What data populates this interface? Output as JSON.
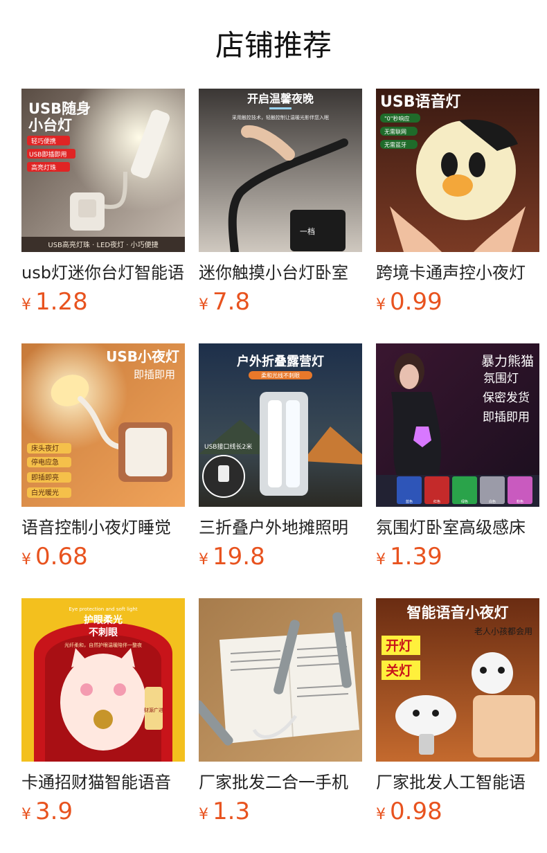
{
  "header": {
    "title": "店铺推荐"
  },
  "currency": "¥",
  "products": [
    {
      "name": "usb灯迷你台灯智能语",
      "price": "1.28",
      "image_text": {
        "headline1": "USB随身",
        "headline2": "小台灯",
        "tags": [
          "轻巧便携",
          "USB即插即用",
          "高亮灯珠"
        ],
        "footer": "USB高亮灯珠 · LED夜灯 · 小巧便捷"
      }
    },
    {
      "name": "迷你触摸小台灯卧室",
      "price": "7.8",
      "image_text": {
        "headline": "开启温馨夜晚",
        "sub": "采用触控技术，轻触控制让温暖光影伴您入眠",
        "badge": "一档"
      }
    },
    {
      "name": "跨境卡通声控小夜灯",
      "price": "0.99",
      "image_text": {
        "headline": "USB语音灯",
        "tags": [
          "\"0\"秒响应",
          "无需联网",
          "无需蓝牙"
        ]
      }
    },
    {
      "name": "语音控制小夜灯睡觉",
      "price": "0.68",
      "image_text": {
        "headline": "USB小夜灯",
        "sub": "即插即用",
        "tags": [
          "床头夜灯",
          "停电应急",
          "即插即亮",
          "白光暖光"
        ]
      }
    },
    {
      "name": "三折叠户外地摊照明",
      "price": "19.8",
      "image_text": {
        "headline": "户外折叠露营灯",
        "sub": "柔和光线不刺眼",
        "note": "USB接口线长2米"
      }
    },
    {
      "name": "氛围灯卧室高级感床",
      "price": "1.39",
      "image_text": {
        "lines": [
          "暴力熊猫",
          "氛围灯",
          "保密发货",
          "即插即用"
        ],
        "swatches": [
          "蓝色",
          "红色",
          "绿色",
          "白色",
          "粉色"
        ]
      }
    },
    {
      "name": "卡通招财猫智能语音",
      "price": "3.9",
      "image_text": {
        "top": "Eye protection and soft light",
        "headline1": "护眼柔光",
        "headline2": "不刺眼",
        "sub": "光纤柔和，自然护眼温暖陪伴一整夜",
        "scroll": "财源广进"
      }
    },
    {
      "name": "厂家批发二合一手机",
      "price": "1.3",
      "image_text": {}
    },
    {
      "name": "厂家批发人工智能语",
      "price": "0.98",
      "image_text": {
        "headline": "智能语音小夜灯",
        "sub": "老人小孩都会用",
        "tags": [
          "开灯",
          "关灯"
        ]
      }
    }
  ]
}
